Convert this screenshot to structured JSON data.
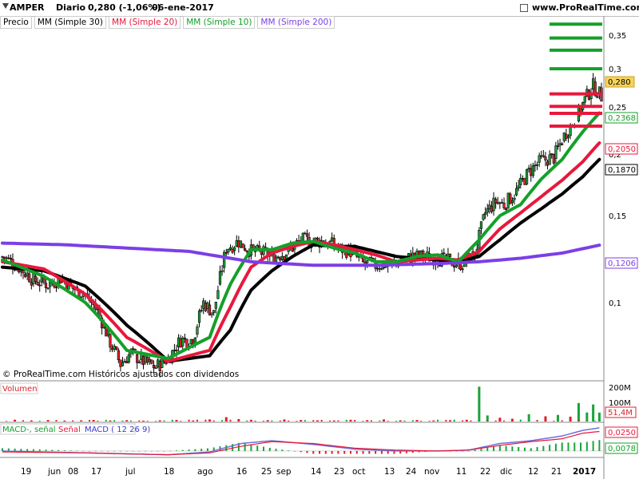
{
  "header": {
    "ticker": "AMPER",
    "period": "Diario",
    "price_change": "0,280 (-1,06%)",
    "date": "06-ene-2017",
    "site": "www.ProRealTime.com"
  },
  "legend": {
    "price": "Precio",
    "mm30": "MM (Simple 30)",
    "mm20": "MM (Simple 20)",
    "mm10": "MM (Simple 10)",
    "mm200": "MM (Simple 200)"
  },
  "colors": {
    "up": "#1aa33a",
    "down": "#e0202a",
    "mm30": "#000000",
    "mm20": "#e8183c",
    "mm10": "#14a02a",
    "mm200": "#7b3fe6",
    "volume": "#e0202a",
    "macd": "#6f6fd8",
    "signal": "#e8183c"
  },
  "copyright": "© ProRealTime.com Históricos ajustados con dividendos",
  "price_axis": {
    "ticks": [
      "0,35",
      "0,3",
      "0,25",
      "0,2",
      "0,15",
      "0,1"
    ],
    "tags": {
      "last": "0,280",
      "mm10": "0,2368",
      "mm20": "0,2050",
      "mm30": "0,1870",
      "mm200": "0,1206"
    }
  },
  "volume_panel": {
    "title": "Volumen",
    "ticks": [
      "200M",
      "100M"
    ],
    "tag": "51,4M"
  },
  "macd_panel": {
    "title_macd": "MACD-, señal",
    "title_signal": "Señal",
    "title_params": "MACD ( 12 26 9)",
    "tags": {
      "upper": "0,0250",
      "lower": "0,0078"
    }
  },
  "x_axis": {
    "labels": [
      "19",
      "jun",
      "08",
      "17",
      "jul",
      "18",
      "ago",
      "16",
      "25",
      "sep",
      "14",
      "23",
      "oct",
      "13",
      "24",
      "nov",
      "11",
      "22",
      "dic",
      "12",
      "21",
      "2017"
    ]
  },
  "chart_data": {
    "type": "candlestick",
    "title": "AMPER Diario",
    "ylim": [
      0.065,
      0.37
    ],
    "y_ticks": [
      0.35,
      0.3,
      0.25,
      0.2,
      0.15,
      0.1
    ],
    "x_label": "",
    "y_label": "",
    "price_path": [
      [
        0,
        0.124
      ],
      [
        8,
        0.118
      ],
      [
        15,
        0.111
      ],
      [
        22,
        0.109
      ],
      [
        28,
        0.112
      ],
      [
        34,
        0.107
      ],
      [
        40,
        0.104
      ],
      [
        46,
        0.096
      ],
      [
        52,
        0.083
      ],
      [
        57,
        0.075
      ],
      [
        62,
        0.079
      ],
      [
        68,
        0.076
      ],
      [
        74,
        0.074
      ],
      [
        80,
        0.077
      ],
      [
        86,
        0.084
      ],
      [
        92,
        0.084
      ],
      [
        97,
        0.1
      ],
      [
        102,
        0.095
      ],
      [
        108,
        0.129
      ],
      [
        114,
        0.133
      ],
      [
        120,
        0.127
      ],
      [
        126,
        0.126
      ],
      [
        132,
        0.124
      ],
      [
        138,
        0.127
      ],
      [
        144,
        0.134
      ],
      [
        150,
        0.133
      ],
      [
        156,
        0.133
      ],
      [
        162,
        0.129
      ],
      [
        168,
        0.127
      ],
      [
        174,
        0.12
      ],
      [
        180,
        0.119
      ],
      [
        186,
        0.12
      ],
      [
        192,
        0.121
      ],
      [
        198,
        0.124
      ],
      [
        204,
        0.124
      ],
      [
        210,
        0.123
      ],
      [
        216,
        0.121
      ],
      [
        222,
        0.12
      ],
      [
        228,
        0.125
      ],
      [
        233,
        0.152
      ],
      [
        238,
        0.16
      ],
      [
        242,
        0.158
      ],
      [
        248,
        0.168
      ],
      [
        254,
        0.184
      ],
      [
        260,
        0.194
      ],
      [
        266,
        0.197
      ],
      [
        272,
        0.222
      ],
      [
        277,
        0.237
      ],
      [
        281,
        0.258
      ],
      [
        285,
        0.275
      ],
      [
        289,
        0.262
      ]
    ],
    "series": [
      {
        "name": "MM (Simple 30)",
        "values": [
          [
            0,
            0.118
          ],
          [
            20,
            0.116
          ],
          [
            40,
            0.108
          ],
          [
            60,
            0.09
          ],
          [
            80,
            0.076
          ],
          [
            100,
            0.078
          ],
          [
            110,
            0.088
          ],
          [
            120,
            0.106
          ],
          [
            130,
            0.116
          ],
          [
            140,
            0.124
          ],
          [
            150,
            0.131
          ],
          [
            160,
            0.13
          ],
          [
            170,
            0.13
          ],
          [
            180,
            0.127
          ],
          [
            190,
            0.124
          ],
          [
            200,
            0.123
          ],
          [
            210,
            0.122
          ],
          [
            220,
            0.121
          ],
          [
            230,
            0.124
          ],
          [
            240,
            0.134
          ],
          [
            250,
            0.145
          ],
          [
            260,
            0.155
          ],
          [
            270,
            0.166
          ],
          [
            280,
            0.18
          ],
          [
            289,
            0.197
          ]
        ]
      },
      {
        "name": "MM (Simple 20)",
        "values": [
          [
            0,
            0.121
          ],
          [
            20,
            0.117
          ],
          [
            40,
            0.104
          ],
          [
            60,
            0.085
          ],
          [
            80,
            0.076
          ],
          [
            100,
            0.08
          ],
          [
            110,
            0.098
          ],
          [
            120,
            0.118
          ],
          [
            130,
            0.126
          ],
          [
            140,
            0.13
          ],
          [
            150,
            0.133
          ],
          [
            160,
            0.131
          ],
          [
            170,
            0.128
          ],
          [
            180,
            0.125
          ],
          [
            190,
            0.121
          ],
          [
            200,
            0.122
          ],
          [
            210,
            0.123
          ],
          [
            220,
            0.122
          ],
          [
            230,
            0.127
          ],
          [
            240,
            0.141
          ],
          [
            250,
            0.152
          ],
          [
            260,
            0.164
          ],
          [
            270,
            0.177
          ],
          [
            280,
            0.193
          ],
          [
            289,
            0.213
          ]
        ]
      },
      {
        "name": "MM (Simple 10)",
        "values": [
          [
            0,
            0.122
          ],
          [
            20,
            0.113
          ],
          [
            40,
            0.1
          ],
          [
            60,
            0.08
          ],
          [
            80,
            0.077
          ],
          [
            100,
            0.085
          ],
          [
            110,
            0.109
          ],
          [
            120,
            0.128
          ],
          [
            130,
            0.128
          ],
          [
            140,
            0.132
          ],
          [
            150,
            0.133
          ],
          [
            160,
            0.129
          ],
          [
            170,
            0.126
          ],
          [
            180,
            0.121
          ],
          [
            190,
            0.121
          ],
          [
            200,
            0.124
          ],
          [
            210,
            0.125
          ],
          [
            220,
            0.121
          ],
          [
            230,
            0.134
          ],
          [
            240,
            0.15
          ],
          [
            250,
            0.158
          ],
          [
            260,
            0.178
          ],
          [
            270,
            0.195
          ],
          [
            280,
            0.222
          ],
          [
            289,
            0.245
          ]
        ]
      },
      {
        "name": "MM (Simple 200)",
        "values": [
          [
            0,
            0.132
          ],
          [
            30,
            0.131
          ],
          [
            60,
            0.129
          ],
          [
            90,
            0.127
          ],
          [
            120,
            0.121
          ],
          [
            150,
            0.119
          ],
          [
            180,
            0.119
          ],
          [
            210,
            0.12
          ],
          [
            230,
            0.121
          ],
          [
            250,
            0.123
          ],
          [
            270,
            0.126
          ],
          [
            289,
            0.131
          ]
        ]
      }
    ],
    "horizontal_levels": {
      "green": [
        0.367,
        0.344,
        0.325,
        0.298
      ],
      "red": [
        0.265,
        0.25,
        0.242,
        0.228
      ]
    },
    "volume": [
      [
        6,
        10
      ],
      [
        14,
        6
      ],
      [
        22,
        8
      ],
      [
        30,
        5
      ],
      [
        38,
        7
      ],
      [
        44,
        9
      ],
      [
        52,
        6
      ],
      [
        60,
        8
      ],
      [
        68,
        5
      ],
      [
        76,
        7
      ],
      [
        84,
        9
      ],
      [
        92,
        6
      ],
      [
        100,
        12
      ],
      [
        108,
        25
      ],
      [
        114,
        14
      ],
      [
        120,
        10
      ],
      [
        128,
        8
      ],
      [
        136,
        12
      ],
      [
        144,
        9
      ],
      [
        152,
        7
      ],
      [
        160,
        6
      ],
      [
        168,
        10
      ],
      [
        176,
        8
      ],
      [
        184,
        12
      ],
      [
        192,
        7
      ],
      [
        200,
        9
      ],
      [
        208,
        6
      ],
      [
        216,
        8
      ],
      [
        224,
        10
      ],
      [
        230,
        200
      ],
      [
        234,
        35
      ],
      [
        240,
        22
      ],
      [
        246,
        16
      ],
      [
        254,
        42
      ],
      [
        262,
        30
      ],
      [
        268,
        38
      ],
      [
        274,
        28
      ],
      [
        278,
        106
      ],
      [
        282,
        52
      ],
      [
        285,
        98
      ],
      [
        288,
        51.4
      ]
    ],
    "volume_ylim": [
      0,
      220
    ],
    "macd": [
      [
        0,
        0.0
      ],
      [
        40,
        -0.002
      ],
      [
        80,
        -0.004
      ],
      [
        100,
        -0.001
      ],
      [
        115,
        0.008
      ],
      [
        130,
        0.011
      ],
      [
        150,
        0.007
      ],
      [
        170,
        0.002
      ],
      [
        190,
        0.0
      ],
      [
        210,
        0.0
      ],
      [
        225,
        0.001
      ],
      [
        240,
        0.008
      ],
      [
        255,
        0.011
      ],
      [
        270,
        0.016
      ],
      [
        280,
        0.022
      ],
      [
        289,
        0.025
      ]
    ],
    "signal": [
      [
        0,
        -0.001
      ],
      [
        40,
        -0.002
      ],
      [
        80,
        -0.004
      ],
      [
        100,
        -0.002
      ],
      [
        115,
        0.005
      ],
      [
        130,
        0.01
      ],
      [
        150,
        0.008
      ],
      [
        170,
        0.003
      ],
      [
        190,
        0.001
      ],
      [
        210,
        0.0
      ],
      [
        225,
        0.001
      ],
      [
        240,
        0.006
      ],
      [
        255,
        0.01
      ],
      [
        270,
        0.013
      ],
      [
        280,
        0.019
      ],
      [
        289,
        0.021
      ]
    ],
    "macd_ylim": [
      -0.006,
      0.028
    ]
  }
}
